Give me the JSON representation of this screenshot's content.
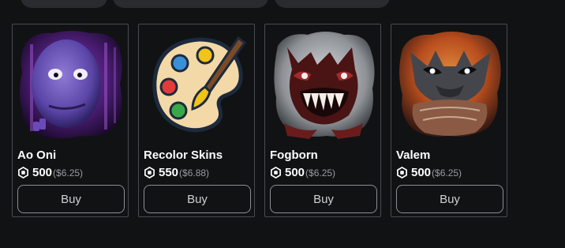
{
  "top_tabs": [
    {
      "label": ""
    },
    {
      "label": ""
    },
    {
      "label": ""
    }
  ],
  "products": [
    {
      "name": "Ao Oni",
      "price": "500",
      "usd": "($6.25)",
      "buy_label": "Buy",
      "image": "ao-oni-thumbnail"
    },
    {
      "name": "Recolor Skins",
      "price": "550",
      "usd": "($6.88)",
      "buy_label": "Buy",
      "image": "paint-palette-thumbnail"
    },
    {
      "name": "Fogborn",
      "price": "500",
      "usd": "($6.25)",
      "buy_label": "Buy",
      "image": "fogborn-thumbnail"
    },
    {
      "name": "Valem",
      "price": "500",
      "usd": "($6.25)",
      "buy_label": "Buy",
      "image": "valem-thumbnail"
    }
  ],
  "colors": {
    "background": "#111214",
    "card_border": "#4a4b4e",
    "text": "#ffffff",
    "muted": "#9a9ba0",
    "button_border": "#8d8e92"
  },
  "icons": {
    "currency": "robux-icon"
  }
}
